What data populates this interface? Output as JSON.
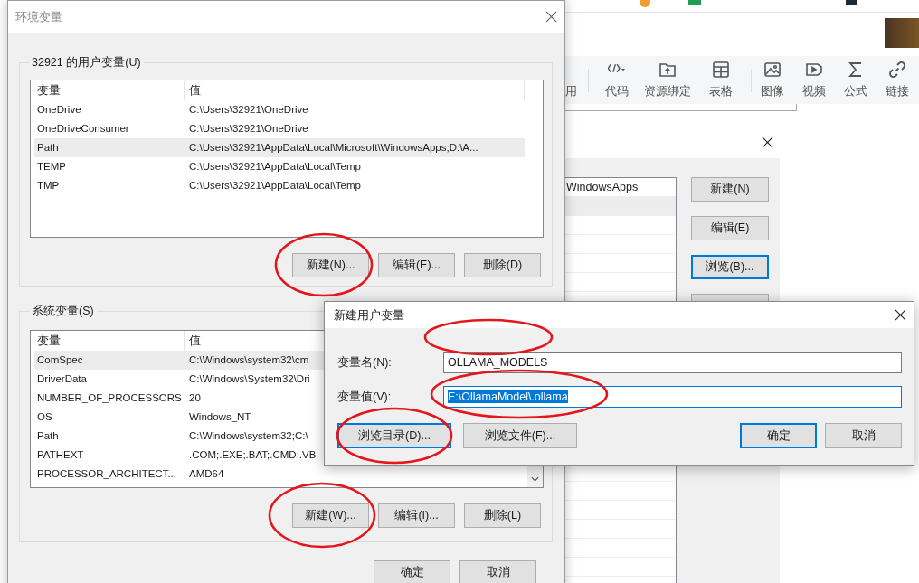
{
  "browser_toolbar": {
    "items": [
      {
        "label": "用"
      },
      {
        "label": "代码"
      },
      {
        "label": "资源绑定"
      },
      {
        "label": "表格"
      },
      {
        "label": "图像"
      },
      {
        "label": "视频"
      },
      {
        "label": "公式"
      },
      {
        "label": "链接"
      }
    ]
  },
  "edit_dialog": {
    "rows": [
      {
        "value": "WindowsApps",
        "selected": false
      },
      {
        "selected": true
      }
    ],
    "buttons": [
      {
        "label": "新建(N)",
        "focused": false
      },
      {
        "label": "编辑(E)",
        "focused": false
      },
      {
        "label": "浏览(B)...",
        "focused": true
      }
    ]
  },
  "env_dialog": {
    "title": "环境变量",
    "user_group": {
      "label": "32921 的用户变量(U)",
      "columns": [
        "变量",
        "值"
      ],
      "rows": [
        {
          "name": "OneDrive",
          "value": "C:\\Users\\32921\\OneDrive",
          "selected": false
        },
        {
          "name": "OneDriveConsumer",
          "value": "C:\\Users\\32921\\OneDrive",
          "selected": false
        },
        {
          "name": "Path",
          "value": "C:\\Users\\32921\\AppData\\Local\\Microsoft\\WindowsApps;D:\\A...",
          "selected": true
        },
        {
          "name": "TEMP",
          "value": "C:\\Users\\32921\\AppData\\Local\\Temp",
          "selected": false
        },
        {
          "name": "TMP",
          "value": "C:\\Users\\32921\\AppData\\Local\\Temp",
          "selected": false
        }
      ],
      "buttons": [
        "新建(N)...",
        "编辑(E)...",
        "删除(D)"
      ]
    },
    "system_group": {
      "label": "系统变量(S)",
      "columns": [
        "变量",
        "值"
      ],
      "rows": [
        {
          "name": "ComSpec",
          "value": "C:\\Windows\\system32\\cm",
          "selected": true
        },
        {
          "name": "DriverData",
          "value": "C:\\Windows\\System32\\Dri",
          "selected": false
        },
        {
          "name": "NUMBER_OF_PROCESSORS",
          "value": "20",
          "selected": false
        },
        {
          "name": "OS",
          "value": "Windows_NT",
          "selected": false
        },
        {
          "name": "Path",
          "value": "C:\\Windows\\system32;C:\\",
          "selected": false
        },
        {
          "name": "PATHEXT",
          "value": ".COM;.EXE;.BAT;.CMD;.VB",
          "selected": false
        },
        {
          "name": "PROCESSOR_ARCHITECT...",
          "value": "AMD64",
          "selected": false
        }
      ],
      "buttons": [
        "新建(W)...",
        "编辑(I)...",
        "删除(L)"
      ]
    },
    "buttons": [
      "确定",
      "取消"
    ]
  },
  "new_var_dialog": {
    "title": "新建用户变量",
    "fields": [
      {
        "label": "变量名(N):",
        "value": "OLLAMA_MODELS",
        "focused": false
      },
      {
        "label": "变量值(V):",
        "value": "E:\\OllamaModel\\.ollama",
        "focused": true
      }
    ],
    "buttons": [
      {
        "label": "浏览目录(D)...",
        "focused": true
      },
      {
        "label": "浏览文件(F)...",
        "focused": false
      },
      {
        "label": "确定",
        "focused": true
      },
      {
        "label": "取消",
        "focused": false
      }
    ]
  }
}
